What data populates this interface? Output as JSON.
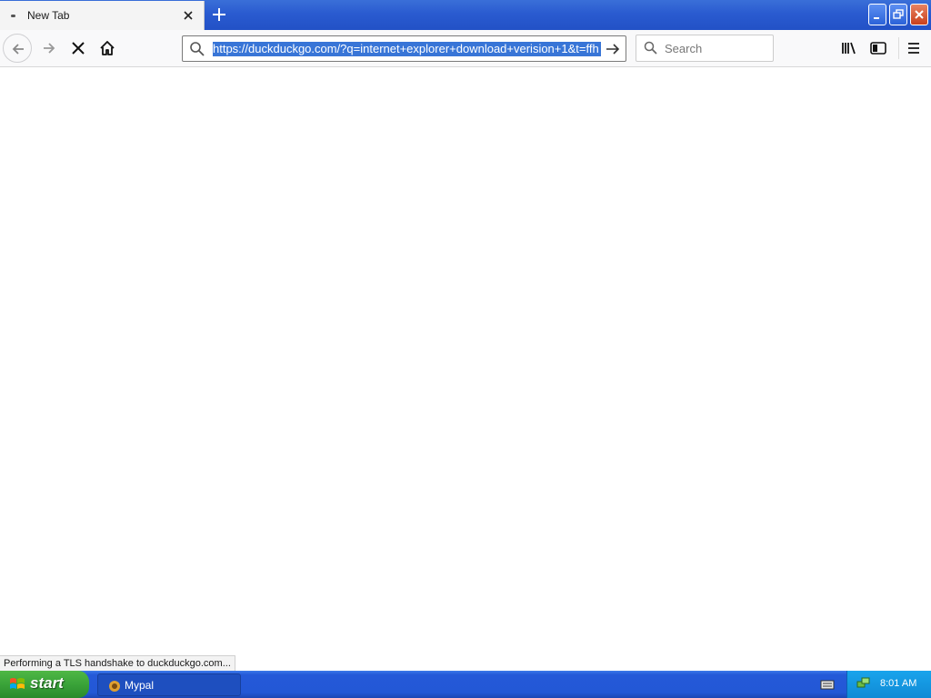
{
  "tab": {
    "title": "New Tab"
  },
  "urlbar": {
    "url": "https://duckduckgo.com/?q=internet+explorer+download+verision+1&t=ffh"
  },
  "searchbar": {
    "placeholder": "Search"
  },
  "status": {
    "text": "Performing a TLS handshake to duckduckgo.com..."
  },
  "taskbar": {
    "start_label": "start",
    "task_label": "Mypal",
    "clock": "8:01 AM"
  },
  "colors": {
    "url_selection": "#3875d7",
    "xp_taskbar_blue": "#2459d8",
    "start_green": "#3aa339",
    "tray_blue": "#19a4ec"
  },
  "icons": [
    "close-icon",
    "plus-icon",
    "minimize-icon",
    "restore-icon",
    "back-arrow-icon",
    "forward-arrow-icon",
    "stop-icon",
    "home-icon",
    "search-icon",
    "go-arrow-icon",
    "library-icon",
    "sidebar-icon",
    "hamburger-menu-icon",
    "windows-flag-icon",
    "app-icon",
    "keyboard-icon",
    "network-icon"
  ]
}
